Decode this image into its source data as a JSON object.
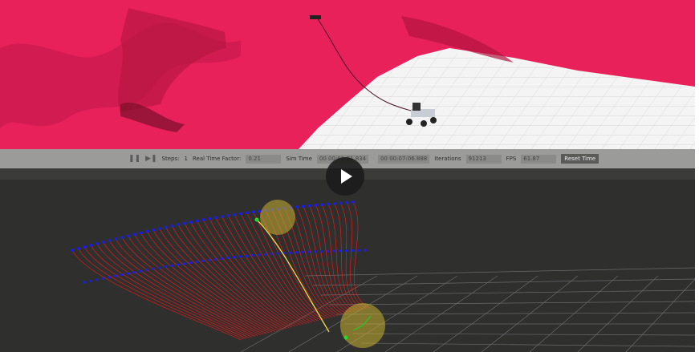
{
  "gazebo": {
    "toolbar": {
      "pause_icon": "pause-icon",
      "step_icon": "step-icon",
      "steps_label": "Steps:",
      "steps_value": "1",
      "rtf_label": "Real Time Factor:",
      "rtf_value": "0.21",
      "sim_time_label": "Sim Time",
      "sim_time_value": "00 00:01:31.834",
      "real_time_label": "",
      "real_time_value": "00 00:07:06.888",
      "iterations_label": "Iterations",
      "iterations_value": "91213",
      "fps_label": "FPS",
      "fps_value": "61.87",
      "reset_label": "Reset Time"
    },
    "colors": {
      "terrain": "#e8215a",
      "ground": "#f2f2f2",
      "toolbar": "#9b9b9a"
    }
  },
  "rviz": {
    "colors": {
      "background": "#2f2f2e",
      "trajectories": "#ff1a1a",
      "endpoints": "#1a1aff",
      "path": "#f0e04a",
      "goal_sphere": "#c9b233"
    }
  },
  "overlay": {
    "play_icon": "play-icon"
  }
}
